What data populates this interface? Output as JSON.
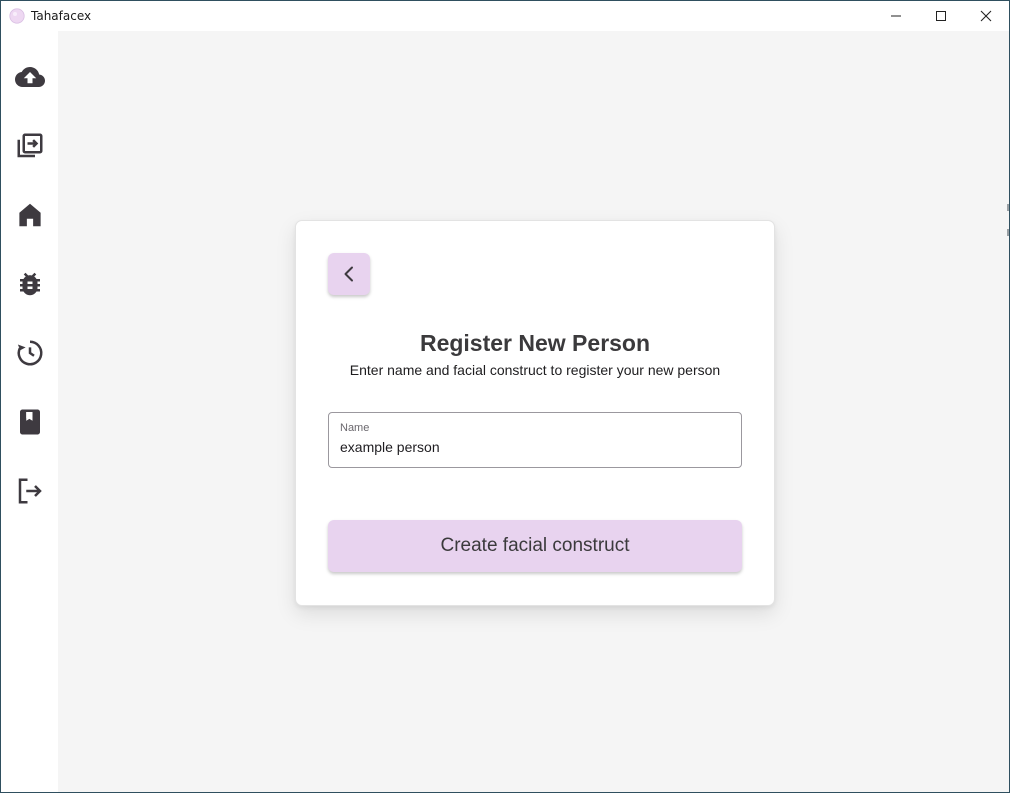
{
  "window": {
    "title": "Tahafacex",
    "controls": [
      "minimize",
      "maximize",
      "close"
    ]
  },
  "sidebar": {
    "items": [
      {
        "name": "upload",
        "icon": "cloud-upload-icon"
      },
      {
        "name": "import",
        "icon": "import-library-icon"
      },
      {
        "name": "home",
        "icon": "home-icon"
      },
      {
        "name": "debug",
        "icon": "bug-icon"
      },
      {
        "name": "history",
        "icon": "history-icon"
      },
      {
        "name": "bookmarks",
        "icon": "bookmark-book-icon"
      },
      {
        "name": "logout",
        "icon": "logout-icon"
      }
    ]
  },
  "register": {
    "back_icon": "chevron-left-icon",
    "title": "Register New Person",
    "subtitle": "Enter name and facial construct to register your new person",
    "name_field": {
      "label": "Name",
      "value": "example person"
    },
    "submit_label": "Create facial construct"
  },
  "colors": {
    "accent": "#e8d3ef",
    "content_background": "#f5f5f5",
    "icon": "#3e3a40",
    "text_dark": "#3b3a3c"
  }
}
